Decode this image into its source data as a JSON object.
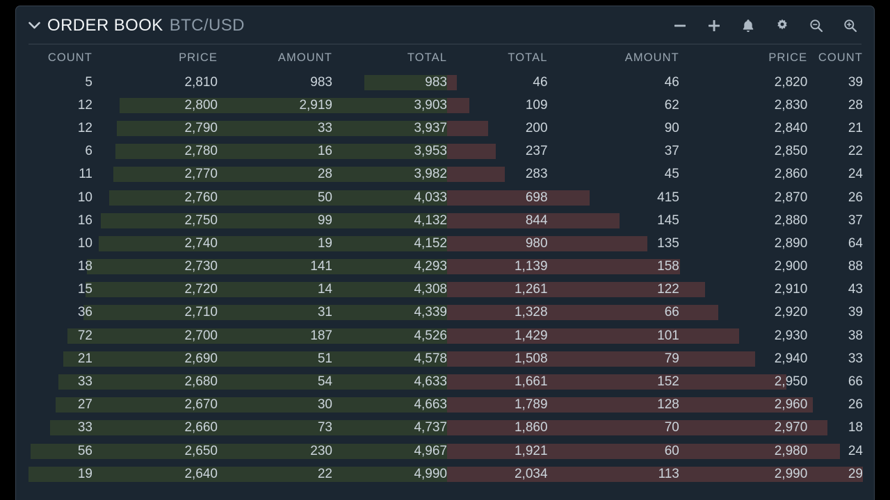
{
  "window": {
    "background_color": "#000000",
    "panel_background": "#1b2631",
    "border_color": "#36424f"
  },
  "header": {
    "collapse_icon": "chevron-down-icon",
    "title": "ORDER BOOK",
    "symbol": "BTC/USD",
    "toolbar": [
      {
        "name": "decrease-precision-button",
        "icon": "minus-icon",
        "label": "−"
      },
      {
        "name": "increase-precision-button",
        "icon": "plus-icon",
        "label": "+"
      },
      {
        "name": "alerts-button",
        "icon": "bell-icon",
        "label": ""
      },
      {
        "name": "settings-button",
        "icon": "gear-icon",
        "label": ""
      },
      {
        "name": "zoom-out-button",
        "icon": "magnifier-minus-icon",
        "label": ""
      },
      {
        "name": "zoom-in-button",
        "icon": "magnifier-plus-icon",
        "label": ""
      }
    ]
  },
  "columns": {
    "bid": [
      "COUNT",
      "PRICE",
      "AMOUNT",
      "TOTAL"
    ],
    "ask": [
      "TOTAL",
      "AMOUNT",
      "PRICE",
      "COUNT"
    ]
  },
  "colors": {
    "bid_depth": "#2d3c2d",
    "ask_depth": "#4a3338",
    "text": "#ccd5dc",
    "header_text": "#9aa7b2",
    "title_text": "#f2f5f7",
    "symbol_text": "#8b99a6"
  },
  "chart_data": {
    "type": "table",
    "title": "ORDER BOOK BTC/USD",
    "bid_columns": [
      "COUNT",
      "PRICE",
      "AMOUNT",
      "TOTAL"
    ],
    "ask_columns": [
      "TOTAL",
      "AMOUNT",
      "PRICE",
      "COUNT"
    ],
    "bids": [
      {
        "count": "5",
        "price": "2,810",
        "amount": "983",
        "total": "983",
        "total_value": 983
      },
      {
        "count": "12",
        "price": "2,800",
        "amount": "2,919",
        "total": "3,903",
        "total_value": 3903
      },
      {
        "count": "12",
        "price": "2,790",
        "amount": "33",
        "total": "3,937",
        "total_value": 3937
      },
      {
        "count": "6",
        "price": "2,780",
        "amount": "16",
        "total": "3,953",
        "total_value": 3953
      },
      {
        "count": "11",
        "price": "2,770",
        "amount": "28",
        "total": "3,982",
        "total_value": 3982
      },
      {
        "count": "10",
        "price": "2,760",
        "amount": "50",
        "total": "4,033",
        "total_value": 4033
      },
      {
        "count": "16",
        "price": "2,750",
        "amount": "99",
        "total": "4,132",
        "total_value": 4132
      },
      {
        "count": "10",
        "price": "2,740",
        "amount": "19",
        "total": "4,152",
        "total_value": 4152
      },
      {
        "count": "18",
        "price": "2,730",
        "amount": "141",
        "total": "4,293",
        "total_value": 4293
      },
      {
        "count": "15",
        "price": "2,720",
        "amount": "14",
        "total": "4,308",
        "total_value": 4308
      },
      {
        "count": "36",
        "price": "2,710",
        "amount": "31",
        "total": "4,339",
        "total_value": 4339
      },
      {
        "count": "72",
        "price": "2,700",
        "amount": "187",
        "total": "4,526",
        "total_value": 4526
      },
      {
        "count": "21",
        "price": "2,690",
        "amount": "51",
        "total": "4,578",
        "total_value": 4578
      },
      {
        "count": "33",
        "price": "2,680",
        "amount": "54",
        "total": "4,633",
        "total_value": 4633
      },
      {
        "count": "27",
        "price": "2,670",
        "amount": "30",
        "total": "4,663",
        "total_value": 4663
      },
      {
        "count": "33",
        "price": "2,660",
        "amount": "73",
        "total": "4,737",
        "total_value": 4737
      },
      {
        "count": "56",
        "price": "2,650",
        "amount": "230",
        "total": "4,967",
        "total_value": 4967
      },
      {
        "count": "19",
        "price": "2,640",
        "amount": "22",
        "total": "4,990",
        "total_value": 4990
      }
    ],
    "asks": [
      {
        "total": "46",
        "amount": "46",
        "price": "2,820",
        "count": "39",
        "total_value": 46
      },
      {
        "total": "109",
        "amount": "62",
        "price": "2,830",
        "count": "28",
        "total_value": 109
      },
      {
        "total": "200",
        "amount": "90",
        "price": "2,840",
        "count": "21",
        "total_value": 200
      },
      {
        "total": "237",
        "amount": "37",
        "price": "2,850",
        "count": "22",
        "total_value": 237
      },
      {
        "total": "283",
        "amount": "45",
        "price": "2,860",
        "count": "24",
        "total_value": 283
      },
      {
        "total": "698",
        "amount": "415",
        "price": "2,870",
        "count": "26",
        "total_value": 698
      },
      {
        "total": "844",
        "amount": "145",
        "price": "2,880",
        "count": "37",
        "total_value": 844
      },
      {
        "total": "980",
        "amount": "135",
        "price": "2,890",
        "count": "64",
        "total_value": 980
      },
      {
        "total": "1,139",
        "amount": "158",
        "price": "2,900",
        "count": "88",
        "total_value": 1139
      },
      {
        "total": "1,261",
        "amount": "122",
        "price": "2,910",
        "count": "43",
        "total_value": 1261
      },
      {
        "total": "1,328",
        "amount": "66",
        "price": "2,920",
        "count": "39",
        "total_value": 1328
      },
      {
        "total": "1,429",
        "amount": "101",
        "price": "2,930",
        "count": "38",
        "total_value": 1429
      },
      {
        "total": "1,508",
        "amount": "79",
        "price": "2,940",
        "count": "33",
        "total_value": 1508
      },
      {
        "total": "1,661",
        "amount": "152",
        "price": "2,950",
        "count": "66",
        "total_value": 1661
      },
      {
        "total": "1,789",
        "amount": "128",
        "price": "2,960",
        "count": "26",
        "total_value": 1789
      },
      {
        "total": "1,860",
        "amount": "70",
        "price": "2,970",
        "count": "18",
        "total_value": 1860
      },
      {
        "total": "1,921",
        "amount": "60",
        "price": "2,980",
        "count": "24",
        "total_value": 1921
      },
      {
        "total": "2,034",
        "amount": "113",
        "price": "2,990",
        "count": "29",
        "total_value": 2034
      }
    ]
  }
}
